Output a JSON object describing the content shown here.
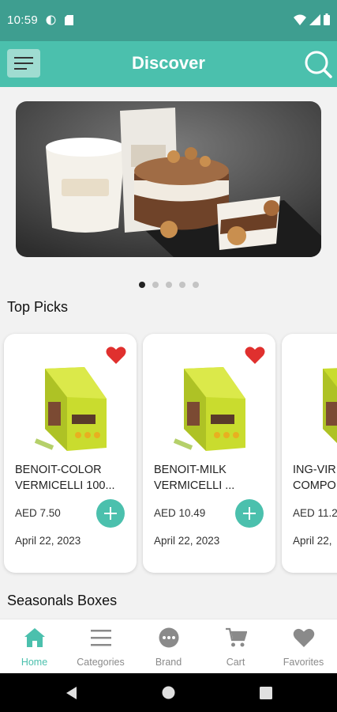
{
  "status_bar": {
    "time": "10:59",
    "icons": [
      "shield-icon",
      "sim-card-icon",
      "wifi-icon",
      "signal-icon",
      "battery-icon"
    ]
  },
  "app_bar": {
    "title": "Discover",
    "menu_icon": "hamburger-menu-icon",
    "search_icon": "search-icon"
  },
  "banner": {
    "image": "cake-product-banner",
    "slide_count": 5,
    "active_slide": 1
  },
  "top_picks": {
    "title": "Top Picks",
    "items": [
      {
        "name": "BENOIT-COLOR\nVERMICELLI 100...",
        "price": "AED 7.50",
        "date": "April 22, 2023",
        "favorited": true
      },
      {
        "name": "BENOIT-MILK\nVERMICELLI  ...",
        "price": "AED 10.49",
        "date": "April 22, 2023",
        "favorited": true
      },
      {
        "name": "ING-VIR\nCOMPO",
        "price": "AED 11.2",
        "date": "April 22,",
        "favorited": false
      }
    ]
  },
  "seasonal": {
    "title": "Seasonals Boxes"
  },
  "bottom_nav": {
    "active": "Home",
    "items": [
      {
        "label": "Home",
        "icon": "home-icon"
      },
      {
        "label": "Categories",
        "icon": "list-icon"
      },
      {
        "label": "Brand",
        "icon": "chat-bubble-icon"
      },
      {
        "label": "Cart",
        "icon": "cart-icon"
      },
      {
        "label": "Favorites",
        "icon": "heart-icon"
      }
    ]
  },
  "colors": {
    "primary": "#4bc0ad",
    "status_bar": "#3e9e90",
    "favorite": "#e0302e"
  }
}
